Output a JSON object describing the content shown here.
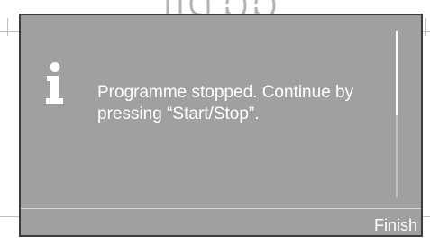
{
  "background": {
    "partial_title": "ng..pp.."
  },
  "dialog": {
    "icon": "info-icon",
    "message": "Programme stopped. Continue by pressing “Start/Stop”.",
    "finish_label": "Finish",
    "scroll_fraction_visible": 0.51
  },
  "colors": {
    "dialog_background": "#a0a0a0",
    "dialog_border": "#3c3c3c",
    "text": "#ffffff",
    "background": "#ffffff"
  }
}
